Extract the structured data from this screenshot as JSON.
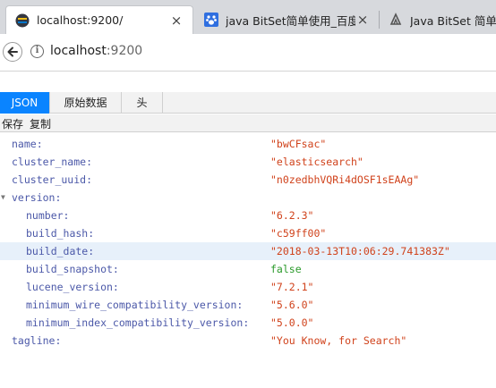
{
  "browser": {
    "tabs": [
      {
        "title": "localhost:9200/",
        "close": "×"
      },
      {
        "title": "java BitSet简单使用_百度搜",
        "close": "×"
      },
      {
        "title": "Java BitSet 简单使"
      }
    ],
    "back_glyph": "←",
    "info_glyph": "i",
    "url_host": "localhost",
    "url_port": ":9200"
  },
  "viewer": {
    "tabs": [
      "JSON",
      "原始数据",
      "头"
    ],
    "actions": [
      "保存",
      "复制"
    ]
  },
  "json": {
    "rows": [
      {
        "key": "name:",
        "value": "\"bwCFsac\""
      },
      {
        "key": "cluster_name:",
        "value": "\"elasticsearch\""
      },
      {
        "key": "cluster_uuid:",
        "value": "\"n0zedbhVQRi4dOSF1sEAAg\""
      },
      {
        "key": "version:",
        "value": ""
      },
      {
        "key": "number:",
        "value": "\"6.2.3\""
      },
      {
        "key": "build_hash:",
        "value": "\"c59ff00\""
      },
      {
        "key": "build_date:",
        "value": "\"2018-03-13T10:06:29.741383Z\""
      },
      {
        "key": "build_snapshot:",
        "value": "false"
      },
      {
        "key": "lucene_version:",
        "value": "\"7.2.1\""
      },
      {
        "key": "minimum_wire_compatibility_version:",
        "value": "\"5.6.0\""
      },
      {
        "key": "minimum_index_compatibility_version:",
        "value": "\"5.0.0\""
      },
      {
        "key": "tagline:",
        "value": "\"You Know, for Search\""
      }
    ]
  },
  "colors": {
    "json_key": "#4b58a8",
    "json_string": "#d0421b",
    "json_bool": "#2b9a2b",
    "active_tab": "#0a84ff"
  }
}
